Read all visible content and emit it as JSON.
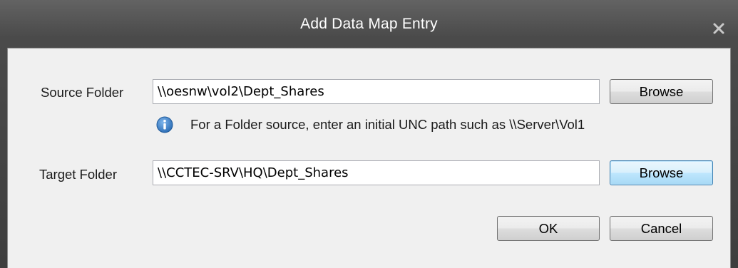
{
  "window": {
    "title": "Add Data Map Entry",
    "close_icon": "close-icon"
  },
  "source": {
    "label": "Source Folder",
    "value": "\\\\oesnw\\vol2\\Dept_Shares",
    "browse_label": "Browse"
  },
  "hint": {
    "icon": "info-icon",
    "text": "For a Folder source, enter an initial UNC path such as \\\\Server\\Vol1"
  },
  "target": {
    "label": "Target Folder",
    "value": "\\\\CCTEC-SRV\\HQ\\Dept_Shares",
    "browse_label": "Browse"
  },
  "actions": {
    "ok_label": "OK",
    "cancel_label": "Cancel"
  },
  "colors": {
    "titlebar": "#4a4a4a",
    "client_background": "#f0f0f0",
    "info_icon": "#2e6fb7",
    "focused_button": "#bee6fd"
  }
}
